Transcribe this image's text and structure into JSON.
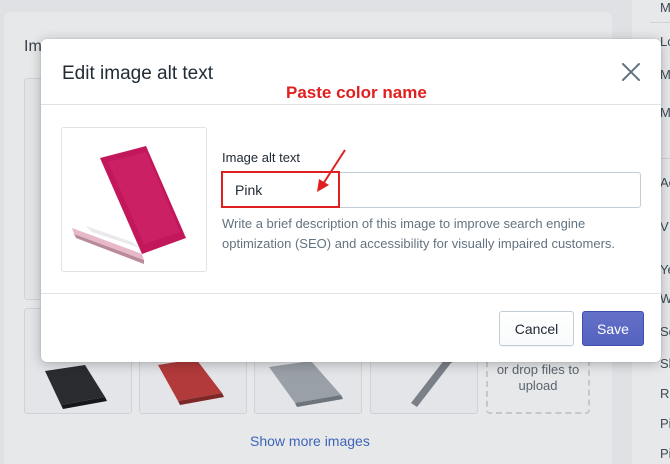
{
  "background": {
    "card_title": "Im",
    "drop_zone_text": "or drop files to upload",
    "show_more_link": "Show more images",
    "sidebar_letters": [
      "M",
      "Lo",
      "M",
      "M",
      "Ac",
      "V",
      "Ye",
      "W",
      "Se",
      "Sl",
      "Re",
      "Pi",
      "Pi"
    ]
  },
  "modal": {
    "title": "Edit image alt text",
    "close_icon": "close-icon",
    "field_label": "Image alt text",
    "alt_text_value": "Pink",
    "help_text": "Write a brief description of this image to improve search engine optimization (SEO) and accessibility for visually impaired customers.",
    "cancel_label": "Cancel",
    "save_label": "Save"
  },
  "annotation": {
    "text": "Paste color name",
    "color": "#e02020"
  },
  "colors": {
    "primary": "#5c6ac4",
    "laptop_pink": "#c2185b"
  }
}
